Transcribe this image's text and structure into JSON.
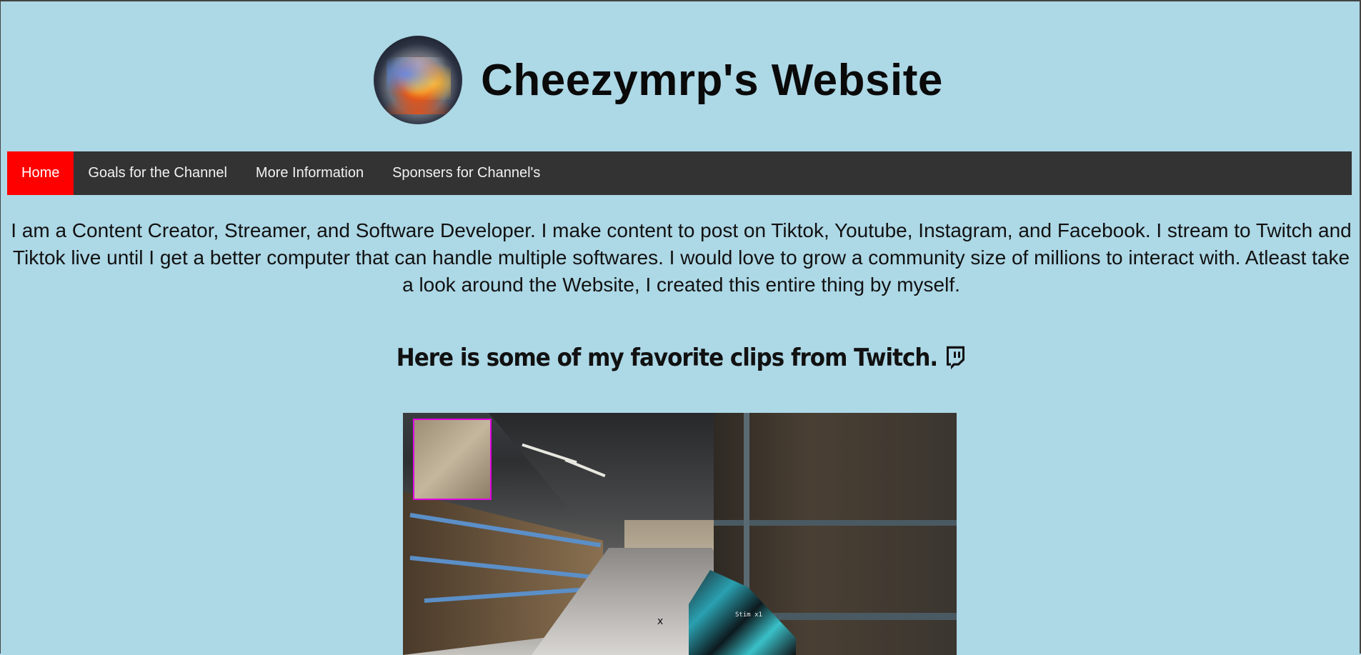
{
  "header": {
    "logo": "channel-logo",
    "title": "Cheezymrp's Website"
  },
  "nav": {
    "items": [
      {
        "label": "Home",
        "active": true
      },
      {
        "label": "Goals for the Channel",
        "active": false
      },
      {
        "label": "More Information",
        "active": false
      },
      {
        "label": "Sponsers for Channel's",
        "active": false
      }
    ],
    "active_color": "#ff0000",
    "bar_color": "#333333"
  },
  "intro": {
    "text": "I am a Content Creator, Streamer, and Software Developer. I make content to post on Tiktok, Youtube, Instagram, and Facebook. I stream to Twitch and Tiktok live until I get a better computer that can handle multiple softwares. I would love to grow a community size of millions to interact with. Atleast take a look around the Website, I created this entire thing by myself."
  },
  "clips": {
    "heading": "Here is some of my favorite clips from Twitch.",
    "heading_icon": "twitch-icon",
    "clip": {
      "type": "video-clip",
      "hud_label": "Stim x1"
    }
  },
  "colors": {
    "page_background": "#add8e6"
  }
}
